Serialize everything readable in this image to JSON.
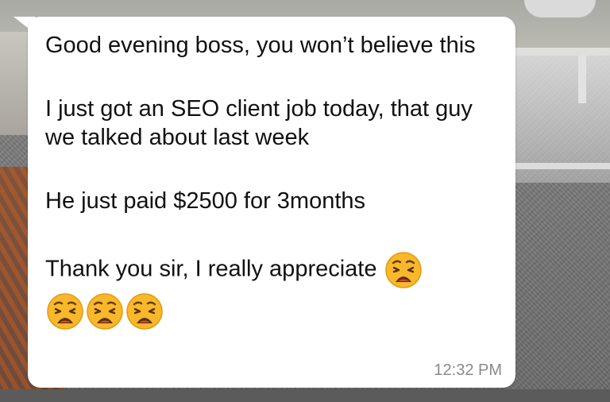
{
  "message": {
    "paragraphs": [
      "Good evening boss, you won’t believe this",
      "I just got an SEO client job today, that guy we talked about last week",
      "He just paid $2500 for 3months",
      "Thank you sir, I really appreciate"
    ],
    "inline_emoji": "weary-face-emoji",
    "trailing_emoji_count": 3,
    "trailing_emoji": "weary-face-emoji",
    "timestamp": "12:32 PM"
  },
  "colors": {
    "bubble": "#ffffff",
    "text": "#111111",
    "timestamp": "#8a8a8a",
    "emoji_face": "#f7b82b"
  }
}
